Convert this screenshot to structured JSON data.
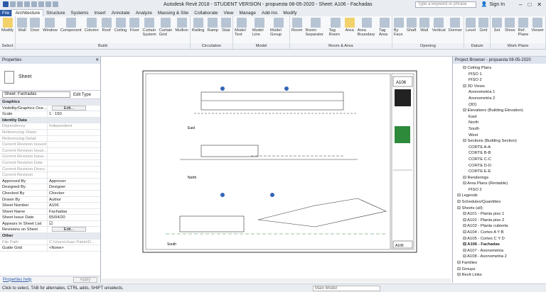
{
  "app": {
    "title": "Autodesk Revit 2018 - STUDENT VERSION -    propuesta 08-05-2020 - Sheet: A106 - Fachadas",
    "search_placeholder": "Type a keyword or phrase",
    "sign_in": "Sign In"
  },
  "tabs": [
    "File",
    "Architecture",
    "Structure",
    "Systems",
    "Insert",
    "Annotate",
    "Analyze",
    "Massing & Site",
    "Collaborate",
    "View",
    "Manage",
    "Add-Ins",
    "Modify"
  ],
  "active_tab": "Architecture",
  "ribbon": {
    "select": {
      "buttons": [
        "Modify"
      ],
      "label": "Select"
    },
    "build": {
      "buttons": [
        "Wall",
        "Door",
        "Window",
        "Component",
        "Column",
        "Roof",
        "Ceiling",
        "Floor",
        "Curtain System",
        "Curtain Grid",
        "Mullion"
      ],
      "label": "Build"
    },
    "circulation": {
      "buttons": [
        "Railing",
        "Ramp",
        "Stair"
      ],
      "label": "Circulation"
    },
    "model": {
      "buttons": [
        "Model Text",
        "Model Line",
        "Model Group"
      ],
      "label": "Model"
    },
    "room": {
      "buttons": [
        "Room",
        "Room Separator",
        "Tag Room",
        "Area",
        "Area Boundary",
        "Tag Area"
      ],
      "label": "Room & Area"
    },
    "opening": {
      "buttons": [
        "By Face",
        "Shaft",
        "Wall",
        "Vertical",
        "Dormer"
      ],
      "label": "Opening"
    },
    "datum": {
      "buttons": [
        "Level",
        "Grid"
      ],
      "label": "Datum"
    },
    "workplane": {
      "buttons": [
        "Set",
        "Show",
        "Ref. Plane",
        "Viewer"
      ],
      "label": "Work Plane"
    }
  },
  "properties": {
    "header": "Properties",
    "type_name": "Sheet",
    "filter": "Sheet: Fachadas",
    "edit_type": "Edit Type",
    "rows": [
      {
        "k": "Graphics",
        "sec": true
      },
      {
        "k": "Visibility/Graphics Ove...",
        "v": "",
        "btn": "Edit..."
      },
      {
        "k": "Scale",
        "v": "1 : 150"
      },
      {
        "k": "Identity Data",
        "sec": true
      },
      {
        "k": "Dependency",
        "v": "Independent",
        "grey": true
      },
      {
        "k": "Referencing Sheet",
        "v": "",
        "grey": true
      },
      {
        "k": "Referencing Detail",
        "v": "",
        "grey": true
      },
      {
        "k": "Current Revision Issued",
        "v": "",
        "grey": true
      },
      {
        "k": "Current Revision Issue...",
        "v": "",
        "grey": true
      },
      {
        "k": "Current Revision Issue...",
        "v": "",
        "grey": true
      },
      {
        "k": "Current Revision Date",
        "v": "",
        "grey": true
      },
      {
        "k": "Current Revision Descr...",
        "v": "",
        "grey": true
      },
      {
        "k": "Current Revision",
        "v": "",
        "grey": true
      },
      {
        "k": "Approved By",
        "v": "Approver"
      },
      {
        "k": "Designed By",
        "v": "Designer"
      },
      {
        "k": "Checked By",
        "v": "Checker"
      },
      {
        "k": "Drawn By",
        "v": "Author"
      },
      {
        "k": "Sheet Number",
        "v": "A106"
      },
      {
        "k": "Sheet Name",
        "v": "Fachadas"
      },
      {
        "k": "Sheet Issue Date",
        "v": "05/04/20"
      },
      {
        "k": "Appears In Sheet List",
        "v": "☑"
      },
      {
        "k": "Revisions on Sheet",
        "v": "",
        "btn": "Edit..."
      },
      {
        "k": "Other",
        "sec": true
      },
      {
        "k": "File Path",
        "v": "C:\\Users\\Juan Pablo\\D...",
        "grey": true
      },
      {
        "k": "Guide Grid",
        "v": "<None>"
      }
    ],
    "help": "Properties help",
    "apply": "Apply"
  },
  "browser": {
    "header": "Project Browser - propuesta 08-05-2020",
    "items": [
      {
        "t": "Ceiling Plans",
        "d": 1
      },
      {
        "t": "PISO 1",
        "d": 2
      },
      {
        "t": "PISO 2",
        "d": 2
      },
      {
        "t": "3D Views",
        "d": 1
      },
      {
        "t": "Axonometria 1",
        "d": 2
      },
      {
        "t": "Axonometria 2",
        "d": 2
      },
      {
        "t": "{3D}",
        "d": 2
      },
      {
        "t": "Elevations (Building Elevation)",
        "d": 1
      },
      {
        "t": "East",
        "d": 2
      },
      {
        "t": "North",
        "d": 2
      },
      {
        "t": "South",
        "d": 2
      },
      {
        "t": "West",
        "d": 2
      },
      {
        "t": "Sections (Building Section)",
        "d": 1
      },
      {
        "t": "CORTE A-A",
        "d": 2
      },
      {
        "t": "CORTE B-B",
        "d": 2
      },
      {
        "t": "CORTE C-C",
        "d": 2
      },
      {
        "t": "CORTE D-D",
        "d": 2
      },
      {
        "t": "CORTE E-E",
        "d": 2
      },
      {
        "t": "Renderings",
        "d": 1
      },
      {
        "t": "Area Plans (Rentable)",
        "d": 1
      },
      {
        "t": "PISO 2",
        "d": 2
      },
      {
        "t": "Legends",
        "d": 0
      },
      {
        "t": "Schedules/Quantities",
        "d": 0
      },
      {
        "t": "Sheets (all)",
        "d": 0
      },
      {
        "t": "A101 - Planta piso 1",
        "d": 1
      },
      {
        "t": "A102 - Planta piso 2",
        "d": 1
      },
      {
        "t": "A103 - Planta cubierta",
        "d": 1
      },
      {
        "t": "A104 - Cortes A Y B",
        "d": 1
      },
      {
        "t": "A105 - Cortes C Y D",
        "d": 1
      },
      {
        "t": "A106 - Fachadas",
        "d": 1,
        "bold": true
      },
      {
        "t": "A107 - Axonometria",
        "d": 1
      },
      {
        "t": "A108 - Axonometria 2",
        "d": 1
      },
      {
        "t": "Families",
        "d": 0
      },
      {
        "t": "Groups",
        "d": 0
      },
      {
        "t": "Revit Links",
        "d": 0
      }
    ]
  },
  "sheet": {
    "number": "A106",
    "name": "Fachadas",
    "views": [
      "East",
      "North",
      "South"
    ],
    "scale": "1 : 150"
  },
  "status": {
    "text": "Click to select, TAB for alternates, CTRL adds, SHIFT unselects.",
    "model": "Main Model"
  }
}
